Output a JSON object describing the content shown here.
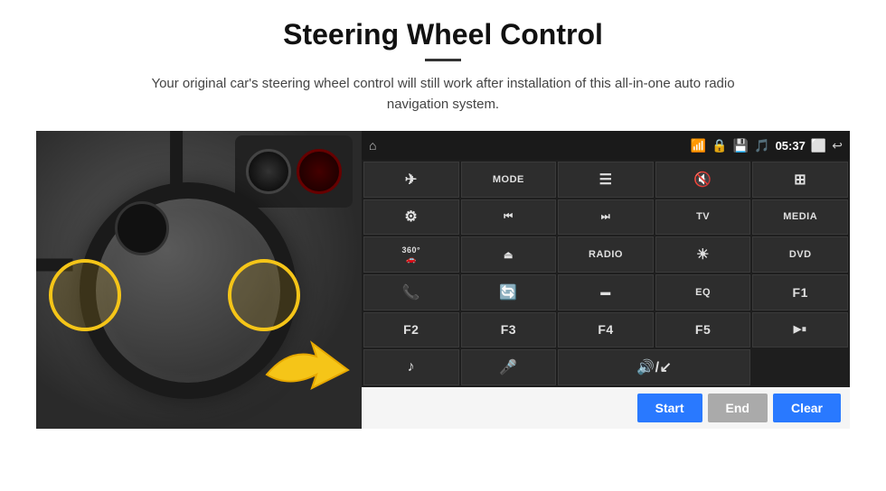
{
  "page": {
    "title": "Steering Wheel Control",
    "subtitle": "Your original car's steering wheel control will still work after installation of this all-in-one auto radio navigation system.",
    "divider": "—"
  },
  "status_bar": {
    "time": "05:37",
    "home_icon": "⌂",
    "wifi_icon": "📶",
    "lock_icon": "🔒",
    "sd_icon": "💾",
    "bt_icon": "🎵",
    "window_icon": "⬜",
    "back_icon": "↩"
  },
  "buttons": [
    {
      "label": "✈",
      "row": 1,
      "col": 1
    },
    {
      "label": "MODE",
      "row": 1,
      "col": 2
    },
    {
      "label": "☰",
      "row": 1,
      "col": 3
    },
    {
      "label": "🔇",
      "row": 1,
      "col": 4
    },
    {
      "label": "⊞",
      "row": 1,
      "col": 5
    },
    {
      "label": "⚙",
      "row": 2,
      "col": 1
    },
    {
      "label": "⏮",
      "row": 2,
      "col": 2
    },
    {
      "label": "⏭",
      "row": 2,
      "col": 3
    },
    {
      "label": "TV",
      "row": 2,
      "col": 4
    },
    {
      "label": "MEDIA",
      "row": 2,
      "col": 5
    },
    {
      "label": "360°",
      "row": 3,
      "col": 1
    },
    {
      "label": "⏏",
      "row": 3,
      "col": 2
    },
    {
      "label": "RADIO",
      "row": 3,
      "col": 3
    },
    {
      "label": "☀",
      "row": 3,
      "col": 4
    },
    {
      "label": "DVD",
      "row": 3,
      "col": 5
    },
    {
      "label": "📞",
      "row": 4,
      "col": 1
    },
    {
      "label": "🔄",
      "row": 4,
      "col": 2
    },
    {
      "label": "▬",
      "row": 4,
      "col": 3
    },
    {
      "label": "EQ",
      "row": 4,
      "col": 4
    },
    {
      "label": "F1",
      "row": 4,
      "col": 5
    },
    {
      "label": "F2",
      "row": 5,
      "col": 1
    },
    {
      "label": "F3",
      "row": 5,
      "col": 2
    },
    {
      "label": "F4",
      "row": 5,
      "col": 3
    },
    {
      "label": "F5",
      "row": 5,
      "col": 4
    },
    {
      "label": "▶⏸",
      "row": 5,
      "col": 5
    },
    {
      "label": "♪",
      "row": 6,
      "col": 1
    },
    {
      "label": "🎤",
      "row": 6,
      "col": 2
    },
    {
      "label": "🔊/↙",
      "row": 6,
      "col": 3,
      "span": 2
    }
  ],
  "bottom_buttons": {
    "start": "Start",
    "end": "End",
    "clear": "Clear"
  }
}
